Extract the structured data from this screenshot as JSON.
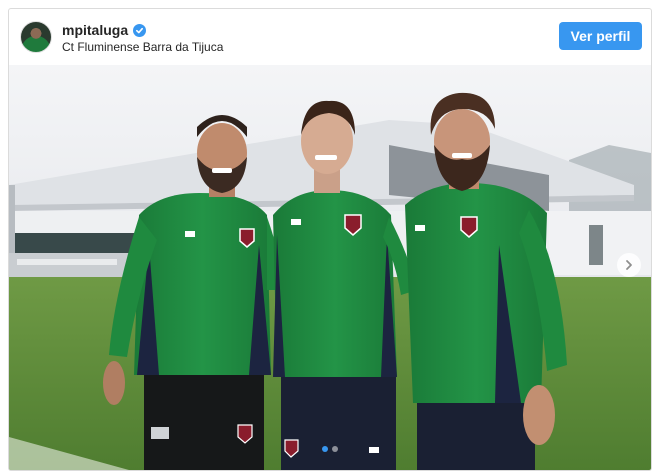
{
  "post": {
    "username": "mpitaluga",
    "location": "Ct Fluminense Barra da Tijuca",
    "view_profile_label": "Ver perfil",
    "carousel": {
      "total_slides": 2,
      "active_slide": 1
    }
  },
  "colors": {
    "accent": "#3897f0",
    "jersey_green": "#1f8a3f",
    "jersey_navy": "#1c2440",
    "grass": "#5f8f3a"
  },
  "icons": {
    "verified": "verified-badge-icon",
    "next": "chevron-right-icon"
  }
}
